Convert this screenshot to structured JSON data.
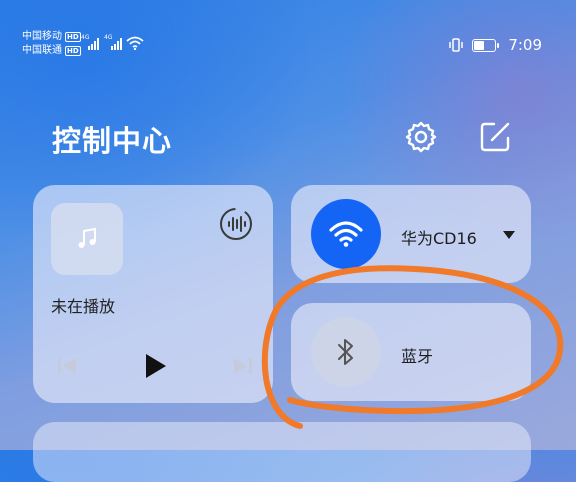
{
  "status_bar": {
    "carrier1": "中国移动",
    "carrier2": "中国联通",
    "hd_badge": "HD",
    "net1": "4G",
    "net2": "4G",
    "time": "7:09",
    "icons": [
      "signal-icon",
      "wifi-icon",
      "vibrate-icon",
      "battery-icon"
    ]
  },
  "header": {
    "title": "控制中心",
    "icons": [
      "gear-icon",
      "edit-icon"
    ]
  },
  "media": {
    "status_text": "未在播放",
    "icons": [
      "music-note-icon",
      "audio-wave-icon",
      "previous-icon",
      "play-icon",
      "next-icon"
    ]
  },
  "wifi": {
    "network_name": "华为CD16",
    "active": true,
    "accent": "#1464f6"
  },
  "bluetooth": {
    "label": "蓝牙",
    "active": false
  },
  "colors": {
    "annotation": "#f07a2a",
    "card": "#ebeefa"
  }
}
